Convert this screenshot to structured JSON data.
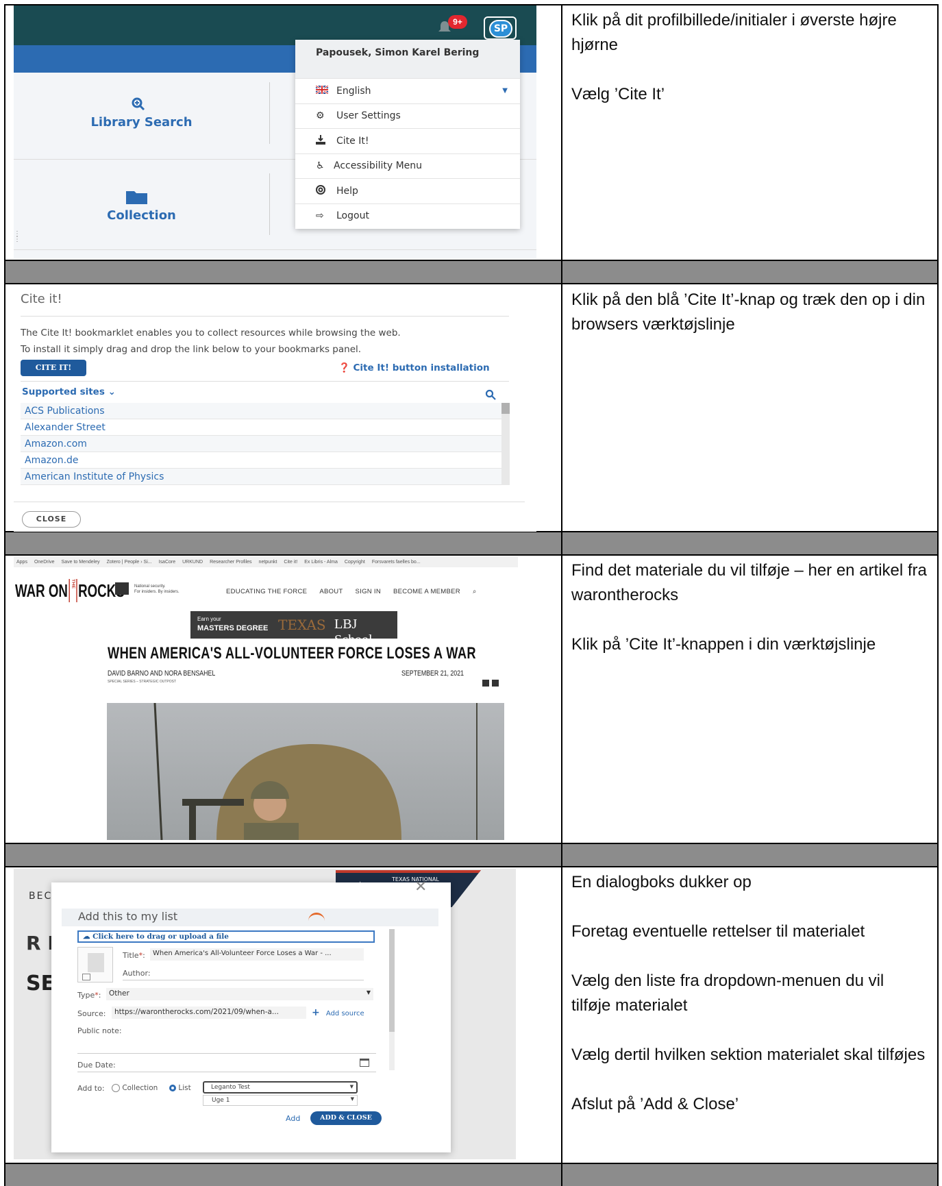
{
  "steps": [
    {
      "instructions": [
        "Klik på dit profilbillede/initialer i øverste højre hjørne",
        "Vælg ’Cite It’"
      ]
    },
    {
      "instructions": [
        "Klik på den blå ’Cite It’-knap og træk den op i din browsers værktøjslinje"
      ]
    },
    {
      "instructions": [
        "Find det materiale du vil tilføje – her en artikel fra warontherocks",
        "Klik på ’Cite It’-knappen i din værktøjslinje"
      ]
    },
    {
      "instructions": [
        "En dialogboks dukker op",
        "Foretag eventuelle rettelser til materialet",
        "Vælg den liste fra dropdown-menuen du vil tilføje materialet",
        "Vælg dertil hvilken sektion materialet skal tilføjes",
        "Afslut på ’Add & Close’"
      ]
    }
  ],
  "panel1": {
    "badge": "9+",
    "avatar": "SP",
    "tiles": [
      "Library Search",
      "Collection"
    ],
    "user_name": "Papousek, Simon Karel Bering",
    "menu": [
      "English",
      "User Settings",
      "Cite It!",
      "Accessibility Menu",
      "Help",
      "Logout"
    ]
  },
  "panel2": {
    "title": "Cite it!",
    "desc1": "The Cite It! bookmarklet enables you to collect resources while browsing the web.",
    "desc2": "To install it simply drag and drop the link below to your bookmarks panel.",
    "cite_button": "CITE IT!",
    "install_link": "Cite It! button installation",
    "supported": "Supported sites",
    "sites": [
      "ACS Publications",
      "Alexander Street",
      "Amazon.com",
      "Amazon.de",
      "American Institute of Physics"
    ],
    "close": "CLOSE"
  },
  "panel3": {
    "bookmarks": [
      "Apps",
      "OneDrive",
      "Save to Mendeley",
      "Zotero | People › Si...",
      "IsaCore",
      "URKUND",
      "Researcher Profiles",
      "netpunkt",
      "Cite it!",
      "Ex Libris - Alma",
      "Copyright",
      "Forsvarets faelles bo..."
    ],
    "logo_left": "WAR ON",
    "logo_mid": "THE",
    "logo_right": "ROCKS",
    "tagline1": "National security.",
    "tagline2": "For insiders. By insiders.",
    "nav": [
      "EDUCATING THE FORCE",
      "ABOUT",
      "SIGN IN",
      "BECOME A MEMBER"
    ],
    "ad_small": "Earn your",
    "ad_big": "MASTERS DEGREE",
    "ad_texas": "TEXAS",
    "ad_lbj": "LBJ School",
    "headline": "WHEN AMERICA'S ALL-VOLUNTEER FORCE LOSES A WAR",
    "authors": "DAVID BARNO AND NORA BENSAHEL",
    "series": "SPECIAL SERIES – STRATEGIC OUTPOST",
    "date": "SEPTEMBER 21, 2021"
  },
  "panel4": {
    "bg_nav": "BECOME A MEMBER",
    "bg_re": "R E",
    "bg_ses": "SES",
    "journal": "TEXAS NATIONAL SECURITY REVIEW",
    "dialog_title": "Add this to my list",
    "upload": "Click here to drag or upload a file",
    "title_label": "Title",
    "title_value": "When America's All-Volunteer Force Loses a War - ...",
    "author_label": "Author:",
    "type_label": "Type",
    "type_value": "Other",
    "source_label": "Source:",
    "source_value": "https://warontherocks.com/2021/09/when-a...",
    "add_source": "Add source",
    "public_note": "Public note:",
    "due_date": "Due Date:",
    "add_to": "Add to:",
    "opt_collection": "Collection",
    "opt_list": "List",
    "list_value": "Leganto Test",
    "section_value": "Uge 1",
    "add": "Add",
    "add_close": "ADD & CLOSE"
  }
}
